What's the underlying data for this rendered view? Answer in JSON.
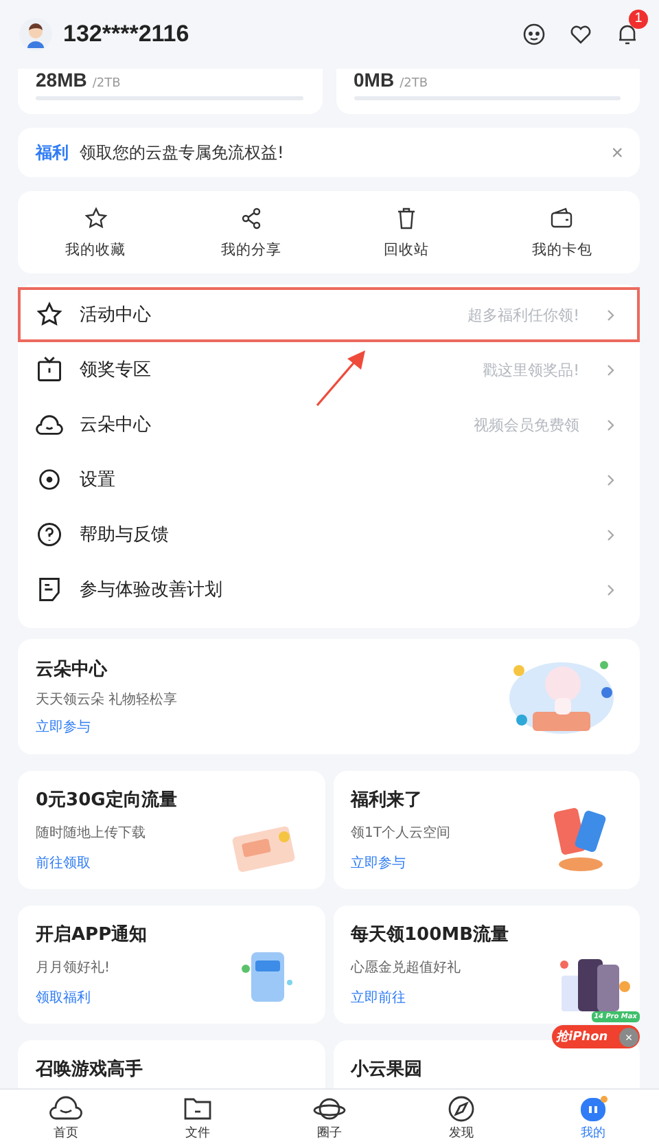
{
  "header": {
    "username": "132****2116",
    "notification_badge": "1"
  },
  "storage": [
    {
      "used": "28MB",
      "total": "/2TB"
    },
    {
      "used": "0MB",
      "total": "/2TB"
    }
  ],
  "notice": {
    "tag": "福利",
    "text": "领取您的云盘专属免流权益!",
    "close": "×"
  },
  "shortcuts": [
    {
      "kind": "star",
      "label": "我的收藏"
    },
    {
      "kind": "share",
      "label": "我的分享"
    },
    {
      "kind": "trash",
      "label": "回收站"
    },
    {
      "kind": "wallet",
      "label": "我的卡包"
    }
  ],
  "menu": [
    {
      "kind": "star",
      "label": "活动中心",
      "hint": "超多福利任你领!",
      "highlighted": true
    },
    {
      "kind": "tv",
      "label": "领奖专区",
      "hint": "戳这里领奖品!",
      "highlighted": false
    },
    {
      "kind": "cloud",
      "label": "云朵中心",
      "hint": "视频会员免费领",
      "highlighted": false
    },
    {
      "kind": "gear",
      "label": "设置",
      "highlighted": false
    },
    {
      "kind": "help",
      "label": "帮助与反馈",
      "highlighted": false
    },
    {
      "kind": "note",
      "label": "参与体验改善计划",
      "highlighted": false
    }
  ],
  "feature_card": {
    "title": "云朵中心",
    "subtitle": "天天领云朵 礼物轻松享",
    "link": "立即参与"
  },
  "cards": [
    {
      "kind": "ticket",
      "title": "0元30G定向流量",
      "subtitle": "随时随地上传下载",
      "link": "前往领取"
    },
    {
      "kind": "phone",
      "title": "福利来了",
      "subtitle": "领1T个人云空间",
      "link": "立即参与"
    },
    {
      "kind": "notify",
      "title": "开启APP通知",
      "subtitle": "月月领好礼!",
      "link": "领取福利"
    },
    {
      "kind": "none",
      "title": "每天领100MB流量",
      "subtitle": "心愿金兑超值好礼",
      "link": "立即前往"
    },
    {
      "kind": "none",
      "title": "召唤游戏高手"
    },
    {
      "kind": "none",
      "title": "小云果园"
    }
  ],
  "promo": {
    "label": "抢iPhon",
    "badge": "14 Pro Max",
    "close": "×"
  },
  "tabs": [
    {
      "kind": "home",
      "label": "首页",
      "selected": false
    },
    {
      "kind": "folder",
      "label": "文件",
      "selected": false
    },
    {
      "kind": "planet",
      "label": "圈子",
      "selected": false
    },
    {
      "kind": "compass",
      "label": "发现",
      "selected": false
    },
    {
      "kind": "me",
      "label": "我的",
      "selected": true
    }
  ]
}
